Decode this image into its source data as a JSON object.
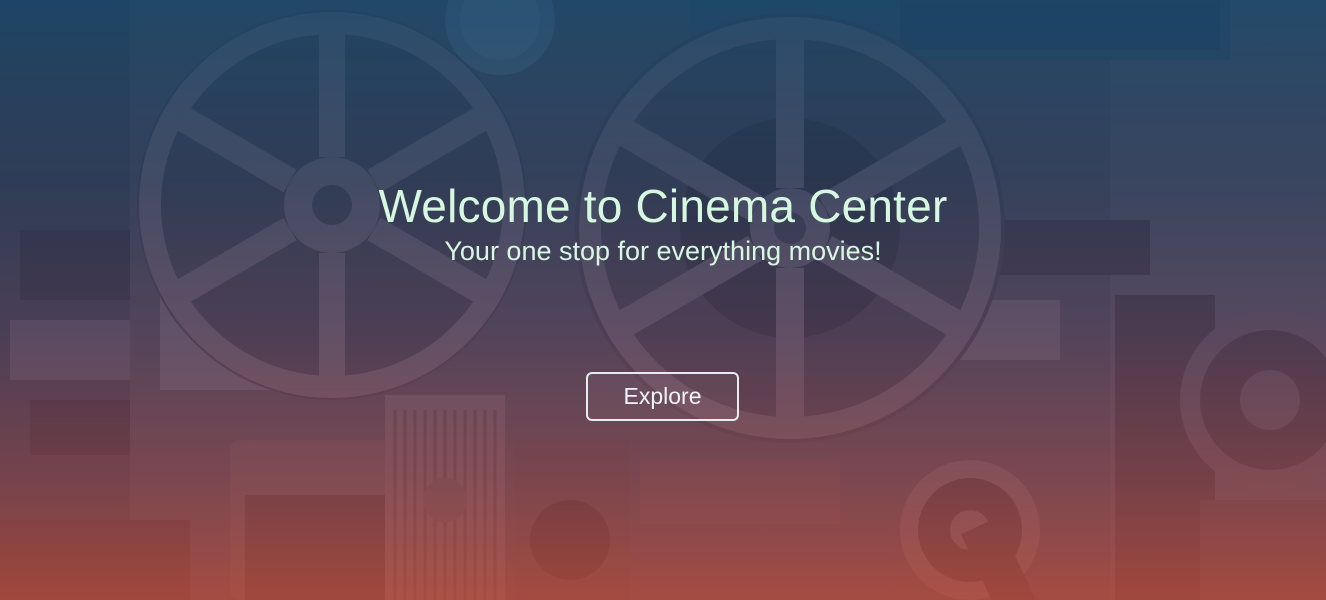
{
  "hero": {
    "title": "Welcome to Cinema Center",
    "subtitle": "Your one stop for everything movies!",
    "explore_label": "Explore",
    "background_image": "film-reels-and-projectors-photo"
  },
  "colors": {
    "text_mint": "#d6f7e0",
    "overlay_top": "#16486e",
    "overlay_bottom": "#be4e3e",
    "button_border": "#e6ecef"
  }
}
